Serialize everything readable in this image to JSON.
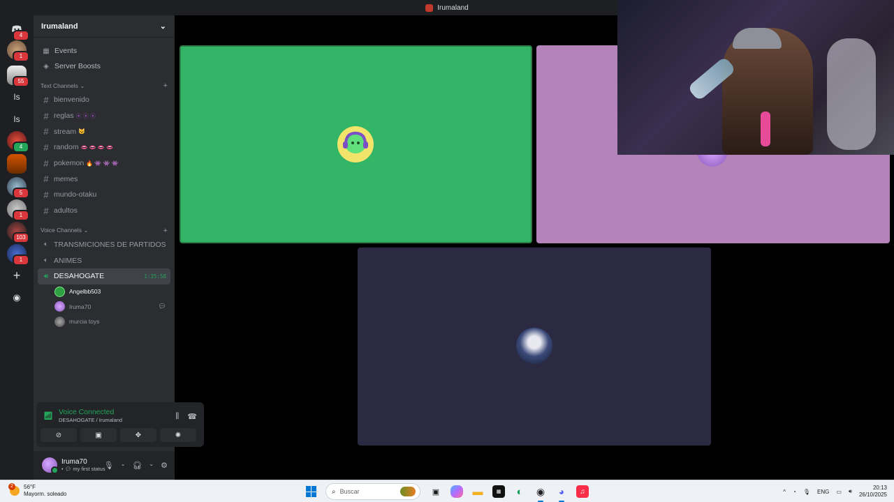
{
  "window": {
    "title": "Irumaland"
  },
  "rail": {
    "badges": [
      "4",
      "1",
      "55",
      "1",
      "5",
      "1",
      "103",
      "1"
    ],
    "text_servers": [
      "Is",
      "Is"
    ]
  },
  "server": {
    "name": "Irumaland"
  },
  "menu": [
    {
      "label": "Events",
      "icon": "calendar-icon"
    },
    {
      "label": "Server Boosts",
      "icon": "boost-icon"
    }
  ],
  "text_category": "Text Channels",
  "text_channels": [
    {
      "label": "bienvenido",
      "emoji": ""
    },
    {
      "label": "reglas",
      "emoji": "⦿ ⦿ ⦿"
    },
    {
      "label": "stream",
      "emoji": "😺"
    },
    {
      "label": "random",
      "emoji": "👄 👄 👄 👄"
    },
    {
      "label": "pokemon",
      "emoji": "🔥 👾 👾 👾"
    },
    {
      "label": "memes",
      "emoji": ""
    },
    {
      "label": "mundo-otaku",
      "emoji": ""
    },
    {
      "label": "adultos",
      "emoji": ""
    }
  ],
  "voice_category": "Voice Channels",
  "voice_channels": [
    {
      "label": "TRANSMICIONES DE PARTIDOS"
    },
    {
      "label": "ANIMES"
    },
    {
      "label": "DESAHOGATE",
      "timer": "1:35:58"
    }
  ],
  "members": [
    {
      "name": "Angelbb503",
      "color": "#2ea043"
    },
    {
      "name": "Iruma70",
      "color": "#b483ba"
    },
    {
      "name": "murcia toys",
      "color": "#6b6b78"
    }
  ],
  "voice_panel": {
    "title": "Voice Connected",
    "subtitle": "DESAHOGATE / Irumaland"
  },
  "user": {
    "name": "Iruma70",
    "status": "my first status"
  },
  "taskbar": {
    "temperature": "56°F",
    "weather": "Mayorm. soleado",
    "weather_badge": "2",
    "search_placeholder": "Buscar",
    "lang": "ENG",
    "time": "20:13",
    "date": "26/10/2025"
  },
  "colors": {
    "accent_green": "#23a55a",
    "tile_green": "#33b567",
    "tile_purple": "#b483ba",
    "tile_dark": "#2b2a42"
  }
}
